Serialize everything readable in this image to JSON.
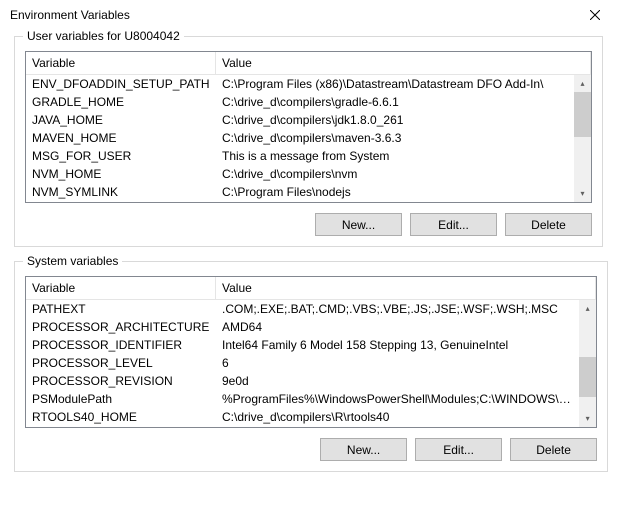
{
  "dialog": {
    "title": "Environment Variables"
  },
  "user": {
    "groupTitle": "User variables for U8004042",
    "headers": {
      "variable": "Variable",
      "value": "Value"
    },
    "rows": [
      {
        "name": "ENV_DFOADDIN_SETUP_PATH",
        "value": "C:\\Program Files (x86)\\Datastream\\Datastream DFO Add-In\\"
      },
      {
        "name": "GRADLE_HOME",
        "value": "C:\\drive_d\\compilers\\gradle-6.6.1"
      },
      {
        "name": "JAVA_HOME",
        "value": "C:\\drive_d\\compilers\\jdk1.8.0_261"
      },
      {
        "name": "MAVEN_HOME",
        "value": "C:\\drive_d\\compilers\\maven-3.6.3"
      },
      {
        "name": "MSG_FOR_USER",
        "value": "This is a message from System"
      },
      {
        "name": "NVM_HOME",
        "value": "C:\\drive_d\\compilers\\nvm"
      },
      {
        "name": "NVM_SYMLINK",
        "value": "C:\\Program Files\\nodejs"
      }
    ],
    "buttons": {
      "new": "New...",
      "edit": "Edit...",
      "delete": "Delete"
    }
  },
  "system": {
    "groupTitle": "System variables",
    "headers": {
      "variable": "Variable",
      "value": "Value"
    },
    "rows": [
      {
        "name": "PATHEXT",
        "value": ".COM;.EXE;.BAT;.CMD;.VBS;.VBE;.JS;.JSE;.WSF;.WSH;.MSC"
      },
      {
        "name": "PROCESSOR_ARCHITECTURE",
        "value": "AMD64"
      },
      {
        "name": "PROCESSOR_IDENTIFIER",
        "value": "Intel64 Family 6 Model 158 Stepping 13, GenuineIntel"
      },
      {
        "name": "PROCESSOR_LEVEL",
        "value": "6"
      },
      {
        "name": "PROCESSOR_REVISION",
        "value": "9e0d"
      },
      {
        "name": "PSModulePath",
        "value": "%ProgramFiles%\\WindowsPowerShell\\Modules;C:\\WINDOWS\\syst..."
      },
      {
        "name": "RTOOLS40_HOME",
        "value": "C:\\drive_d\\compilers\\R\\rtools40"
      }
    ],
    "buttons": {
      "new": "New...",
      "edit": "Edit...",
      "delete": "Delete"
    }
  }
}
